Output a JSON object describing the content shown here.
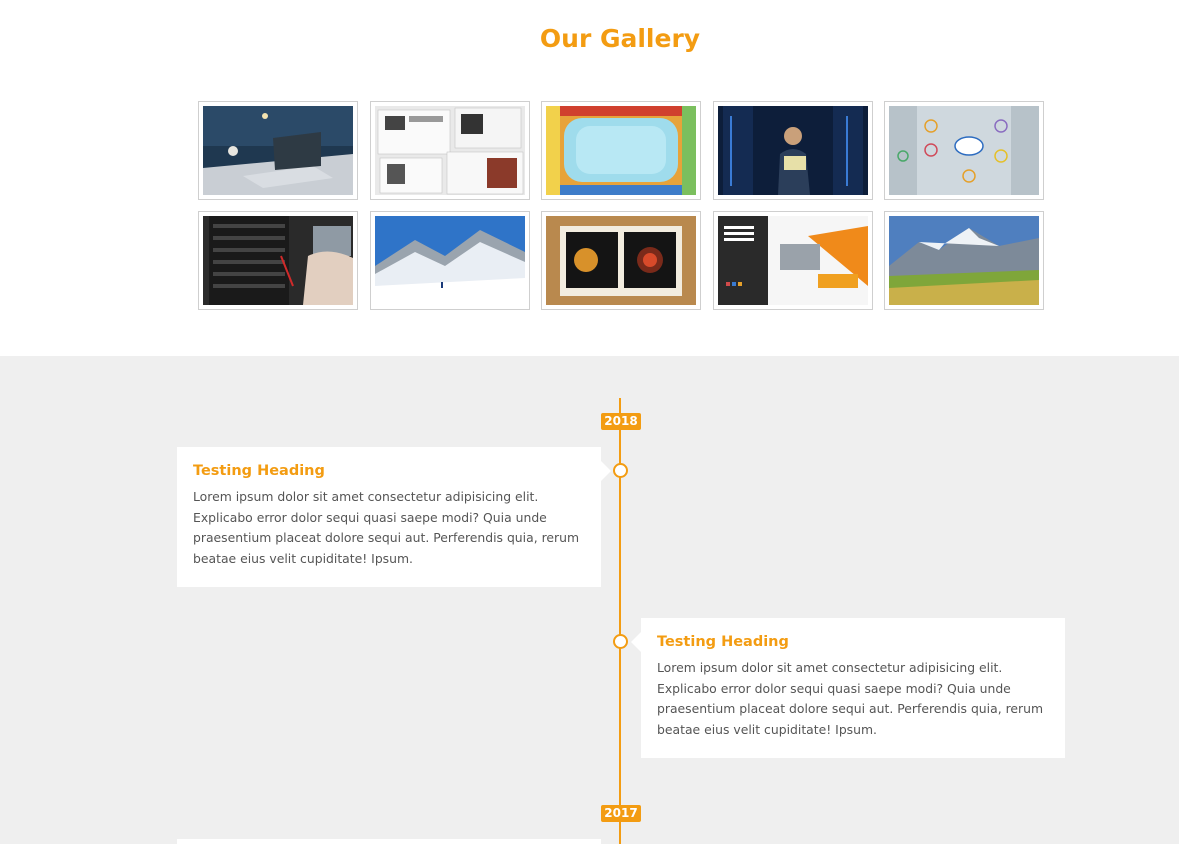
{
  "gallery": {
    "title": "Our Gallery",
    "images": [
      {
        "name": "laptop-desk-image"
      },
      {
        "name": "magazine-spread-image"
      },
      {
        "name": "colored-books-frame-image"
      },
      {
        "name": "server-room-worker-image"
      },
      {
        "name": "cloud-network-icons-image"
      },
      {
        "name": "server-rack-tablet-image"
      },
      {
        "name": "snowy-mountain-image"
      },
      {
        "name": "open-brochure-image"
      },
      {
        "name": "agency-portfolio-brochure-image"
      },
      {
        "name": "alpine-valley-image"
      }
    ]
  },
  "timeline": {
    "years": [
      "2018",
      "2017"
    ],
    "entries": [
      {
        "heading": "Testing Heading",
        "text": "Lorem ipsum dolor sit amet consectetur adipisicing elit. Explicabo error dolor sequi quasi saepe modi? Quia unde praesentium placeat dolore sequi aut. Perferendis quia, rerum beatae eius velit cupiditate! Ipsum."
      },
      {
        "heading": "Testing Heading",
        "text": "Lorem ipsum dolor sit amet consectetur adipisicing elit. Explicabo error dolor sequi quasi saepe modi? Quia unde praesentium placeat dolore sequi aut. Perferendis quia, rerum beatae eius velit cupiditate! Ipsum."
      }
    ]
  },
  "colors": {
    "accent": "#f39c12",
    "timeline_bg": "#efefef",
    "card_bg": "#ffffff"
  }
}
